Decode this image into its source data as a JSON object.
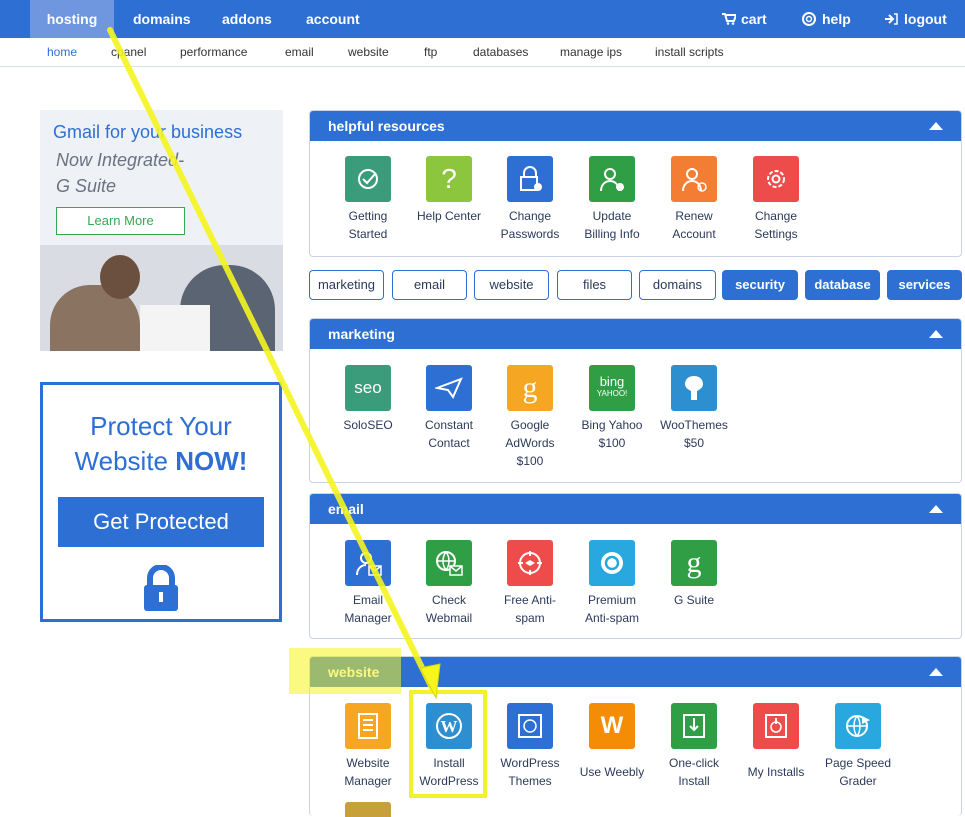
{
  "topnav": {
    "items": [
      "hosting",
      "domains",
      "addons",
      "account"
    ],
    "cart": "cart",
    "help": "help",
    "logout": "logout"
  },
  "subnav": [
    "home",
    "cpanel",
    "performance",
    "email",
    "website",
    "ftp",
    "databases",
    "manage ips",
    "install scripts"
  ],
  "ads": {
    "gsuite": {
      "title": "Gmail for your business",
      "line1": "Now Integrated-",
      "line2": "G Suite",
      "button": "Learn More"
    },
    "protect": {
      "line1": "Protect Your",
      "line2a": "Website ",
      "line2b": "NOW!",
      "button": "Get Protected"
    }
  },
  "panels": {
    "helpful": {
      "title": "helpful resources",
      "tiles": [
        {
          "l1": "Getting",
          "l2": "Started",
          "icon": "check-icon",
          "color": "#3a9c7a"
        },
        {
          "l1": "Help Center",
          "l2": "",
          "icon": "question-icon",
          "color": "#8cc63f"
        },
        {
          "l1": "Change",
          "l2": "Passwords",
          "icon": "lock-gear-icon",
          "color": "#2d6fd3"
        },
        {
          "l1": "Update",
          "l2": "Billing Info",
          "icon": "user-gear-icon",
          "color": "#2f9e44"
        },
        {
          "l1": "Renew",
          "l2": "Account",
          "icon": "user-clock-icon",
          "color": "#f47d34"
        },
        {
          "l1": "Change",
          "l2": "Settings",
          "icon": "gear-icon",
          "color": "#ee4b4b"
        }
      ]
    },
    "filters": [
      "marketing",
      "email",
      "website",
      "files",
      "domains",
      "security",
      "database",
      "services"
    ],
    "marketing": {
      "title": "marketing",
      "tiles": [
        {
          "l1": "SoloSEO",
          "l2": "",
          "l3": "",
          "glyph": "seo",
          "icon": "seo-icon",
          "color": "#3a9c7a"
        },
        {
          "l1": "Constant",
          "l2": "Contact",
          "l3": "",
          "glyph": "",
          "icon": "paper-plane-icon",
          "color": "#2d6fd3"
        },
        {
          "l1": "Google",
          "l2": "AdWords",
          "l3": "$100",
          "glyph": "g",
          "icon": "google-icon",
          "color": "#f5a623"
        },
        {
          "l1": "Bing Yahoo",
          "l2": "$100",
          "l3": "",
          "glyph": "bing",
          "icon": "bing-icon",
          "color": "#2f9e44"
        },
        {
          "l1": "WooThemes",
          "l2": "$50",
          "l3": "",
          "glyph": "",
          "icon": "woo-icon",
          "color": "#2d8fcf"
        }
      ],
      "bing_sub": "YAHOO!"
    },
    "email": {
      "title": "email",
      "tiles": [
        {
          "l1": "Email",
          "l2": "Manager",
          "icon": "user-mail-icon",
          "color": "#2d6fd3"
        },
        {
          "l1": "Check",
          "l2": "Webmail",
          "icon": "globe-mail-icon",
          "color": "#2f9e44"
        },
        {
          "l1": "Free Anti-",
          "l2": "spam",
          "icon": "antispam-icon",
          "color": "#ee4b4b"
        },
        {
          "l1": "Premium",
          "l2": "Anti-spam",
          "icon": "premium-antispam-icon",
          "color": "#29a8e0"
        },
        {
          "l1": "G Suite",
          "l2": "",
          "icon": "g-suite-icon",
          "color": "#2f9e44"
        }
      ]
    },
    "website": {
      "title": "website",
      "tiles": [
        {
          "l1": "Website",
          "l2": "Manager",
          "icon": "website-manager-icon",
          "color": "#f5a623"
        },
        {
          "l1": "Install",
          "l2": "WordPress",
          "icon": "wordpress-icon",
          "color": "#2d8fcf"
        },
        {
          "l1": "WordPress",
          "l2": "Themes",
          "icon": "wordpress-themes-icon",
          "color": "#2d6fd3"
        },
        {
          "l1": "Use Weebly",
          "l2": "",
          "icon": "weebly-icon",
          "color": "#f48c06"
        },
        {
          "l1": "One-click",
          "l2": "Install",
          "icon": "one-click-install-icon",
          "color": "#2f9e44"
        },
        {
          "l1": "My Installs",
          "l2": "",
          "icon": "my-installs-icon",
          "color": "#ee4b4b"
        },
        {
          "l1": "Page Speed",
          "l2": "Grader",
          "icon": "page-speed-icon",
          "color": "#29a8e0"
        }
      ]
    }
  }
}
